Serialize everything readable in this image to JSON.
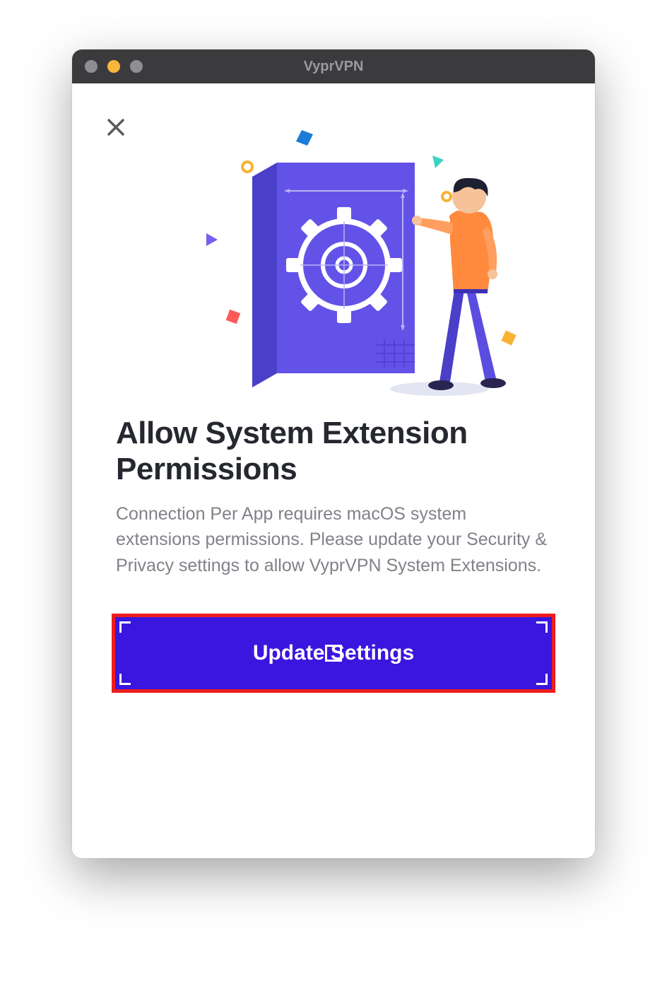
{
  "window": {
    "title": "VyprVPN"
  },
  "dialog": {
    "heading": "Allow System Extension Permissions",
    "body": "Connection Per App requires macOS system extensions permissions. Please update your Security & Privacy settings to allow VyprVPN System Extensions.",
    "primary_button_label": "Update Settings"
  }
}
